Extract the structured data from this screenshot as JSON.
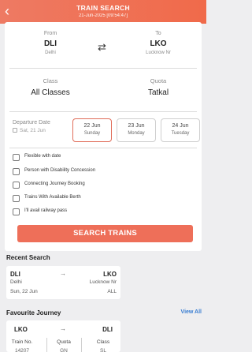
{
  "header": {
    "title": "TRAIN SEARCH",
    "subtitle": "21-Jun-2025 [09:54:47]",
    "bg_color": "#ef6e52"
  },
  "route": {
    "from_label": "From",
    "from_code": "DLI",
    "from_name": "Delhi",
    "to_label": "To",
    "to_code": "LKO",
    "to_name": "Lucknow Nr",
    "swap_icon": "swap-arrows-icon"
  },
  "class_quota": {
    "class_label": "Class",
    "class_value": "All Classes",
    "quota_label": "Quota",
    "quota_value": "Tatkal"
  },
  "departure": {
    "label": "Departure Date",
    "value": "Sat, 21 Jun",
    "dates": [
      {
        "date": "22 Jun",
        "day": "Sunday",
        "selected": true
      },
      {
        "date": "23 Jun",
        "day": "Monday",
        "selected": false
      },
      {
        "date": "24 Jun",
        "day": "Tuesday",
        "selected": false
      }
    ]
  },
  "options": [
    {
      "label": "Flexible with date",
      "checked": false
    },
    {
      "label": "Person with Disability Concession",
      "checked": false
    },
    {
      "label": "Connecting Journey Booking",
      "checked": false
    },
    {
      "label": "Trains With Available Berth",
      "checked": false
    },
    {
      "label": "I'll avail railway pass",
      "checked": false
    }
  ],
  "search_button": "SEARCH TRAINS",
  "recent": {
    "title": "Recent Search",
    "from_code": "DLI",
    "from_name": "Delhi",
    "to_code": "LKO",
    "to_name": "Lucknow Nr",
    "date": "Sun, 22 Jun",
    "class": "ALL",
    "arrow": "→"
  },
  "favourite": {
    "title": "Favourite Journey",
    "view_all": "View All",
    "from_code": "LKO",
    "to_code": "DLI",
    "arrow": "→",
    "train_no_label": "Train No.",
    "train_no": "14207",
    "quota_label": "Quota",
    "quota": "GN",
    "class_label": "Class",
    "class": "SL"
  },
  "colors": {
    "accent": "#ee6f59",
    "link": "#3a7ed2"
  }
}
